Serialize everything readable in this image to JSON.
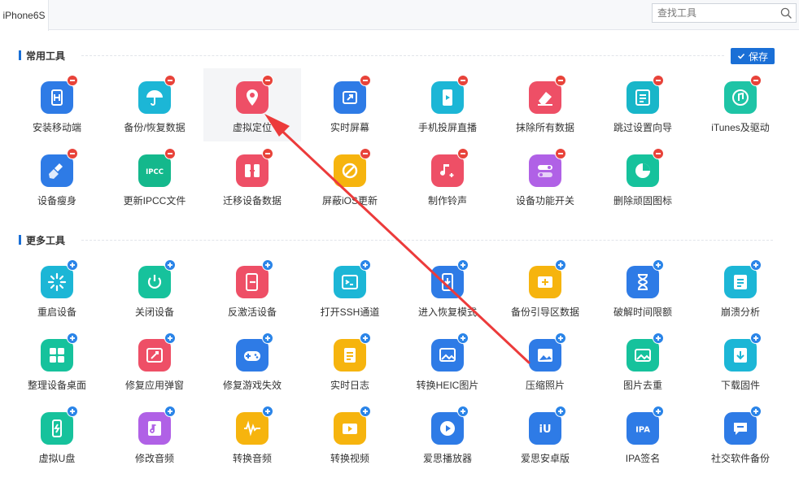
{
  "tab": {
    "label": "iPhone6S"
  },
  "search": {
    "placeholder": "查找工具"
  },
  "sections": {
    "common": {
      "title": "常用工具",
      "save_label": "保存"
    },
    "more": {
      "title": "更多工具"
    }
  },
  "common_tools": [
    {
      "label": "安装移动端",
      "icon": "install-mobile-icon",
      "color": "#2e7be6"
    },
    {
      "label": "备份/恢复数据",
      "icon": "umbrella-icon",
      "color": "#1cb6d6"
    },
    {
      "label": "虚拟定位",
      "icon": "location-pin-icon",
      "color": "#ee4f66"
    },
    {
      "label": "实时屏幕",
      "icon": "screen-mirror-icon",
      "color": "#2e7be6"
    },
    {
      "label": "手机投屏直播",
      "icon": "phone-cast-icon",
      "color": "#1cb6d6"
    },
    {
      "label": "抹除所有数据",
      "icon": "eraser-icon",
      "color": "#ee4f66"
    },
    {
      "label": "跳过设置向导",
      "icon": "skip-setup-icon",
      "color": "#18b6c9"
    },
    {
      "label": "iTunes及驱动",
      "icon": "itunes-icon",
      "color": "#1ec4a6"
    },
    {
      "label": "设备瘦身",
      "icon": "broom-icon",
      "color": "#2e7be6"
    },
    {
      "label": "更新IPCC文件",
      "icon": "ipcc-icon",
      "color": "#14b88c"
    },
    {
      "label": "迁移设备数据",
      "icon": "migrate-icon",
      "color": "#ee4f66"
    },
    {
      "label": "屏蔽iOS更新",
      "icon": "block-update-icon",
      "color": "#f6b40e"
    },
    {
      "label": "制作铃声",
      "icon": "ringtone-icon",
      "color": "#ee4f66"
    },
    {
      "label": "设备功能开关",
      "icon": "toggle-icon",
      "color": "#b061e6"
    },
    {
      "label": "删除顽固图标",
      "icon": "delete-icon-icon",
      "color": "#16c29c"
    }
  ],
  "more_tools": [
    {
      "label": "重启设备",
      "icon": "restart-icon",
      "color": "#1cb6d6"
    },
    {
      "label": "关闭设备",
      "icon": "power-icon",
      "color": "#16c29c"
    },
    {
      "label": "反激活设备",
      "icon": "deactivate-icon",
      "color": "#ee4f66"
    },
    {
      "label": "打开SSH通道",
      "icon": "terminal-icon",
      "color": "#1cb6d6"
    },
    {
      "label": "进入恢复模式",
      "icon": "recovery-icon",
      "color": "#2e7be6"
    },
    {
      "label": "备份引导区数据",
      "icon": "backup-boot-icon",
      "color": "#f6b40e"
    },
    {
      "label": "破解时间限额",
      "icon": "hourglass-icon",
      "color": "#2e7be6"
    },
    {
      "label": "崩溃分析",
      "icon": "crash-log-icon",
      "color": "#1cb6d6"
    },
    {
      "label": "整理设备桌面",
      "icon": "desktop-grid-icon",
      "color": "#16c29c"
    },
    {
      "label": "修复应用弹窗",
      "icon": "fix-popup-icon",
      "color": "#ee4f66"
    },
    {
      "label": "修复游戏失效",
      "icon": "gamepad-icon",
      "color": "#2e7be6"
    },
    {
      "label": "实时日志",
      "icon": "log-icon",
      "color": "#f6b40e"
    },
    {
      "label": "转换HEIC图片",
      "icon": "heic-convert-icon",
      "color": "#2e7be6"
    },
    {
      "label": "压缩照片",
      "icon": "compress-photo-icon",
      "color": "#2e7be6"
    },
    {
      "label": "图片去重",
      "icon": "dedupe-photo-icon",
      "color": "#16c29c"
    },
    {
      "label": "下载固件",
      "icon": "firmware-download-icon",
      "color": "#1cb6d6"
    },
    {
      "label": "虚拟U盘",
      "icon": "usb-drive-icon",
      "color": "#16c29c"
    },
    {
      "label": "修改音频",
      "icon": "audio-edit-icon",
      "color": "#b061e6"
    },
    {
      "label": "转换音频",
      "icon": "audio-convert-icon",
      "color": "#f6b40e"
    },
    {
      "label": "转换视频",
      "icon": "video-convert-icon",
      "color": "#f6b40e"
    },
    {
      "label": "爱思播放器",
      "icon": "player-icon",
      "color": "#2e7be6"
    },
    {
      "label": "爱思安卓版",
      "icon": "android-app-icon",
      "color": "#2e7be6"
    },
    {
      "label": "IPA签名",
      "icon": "ipa-sign-icon",
      "color": "#2e7be6"
    },
    {
      "label": "社交软件备份",
      "icon": "chat-backup-icon",
      "color": "#2e7be6"
    }
  ],
  "annotation": {
    "color": "#ec3b3b"
  }
}
